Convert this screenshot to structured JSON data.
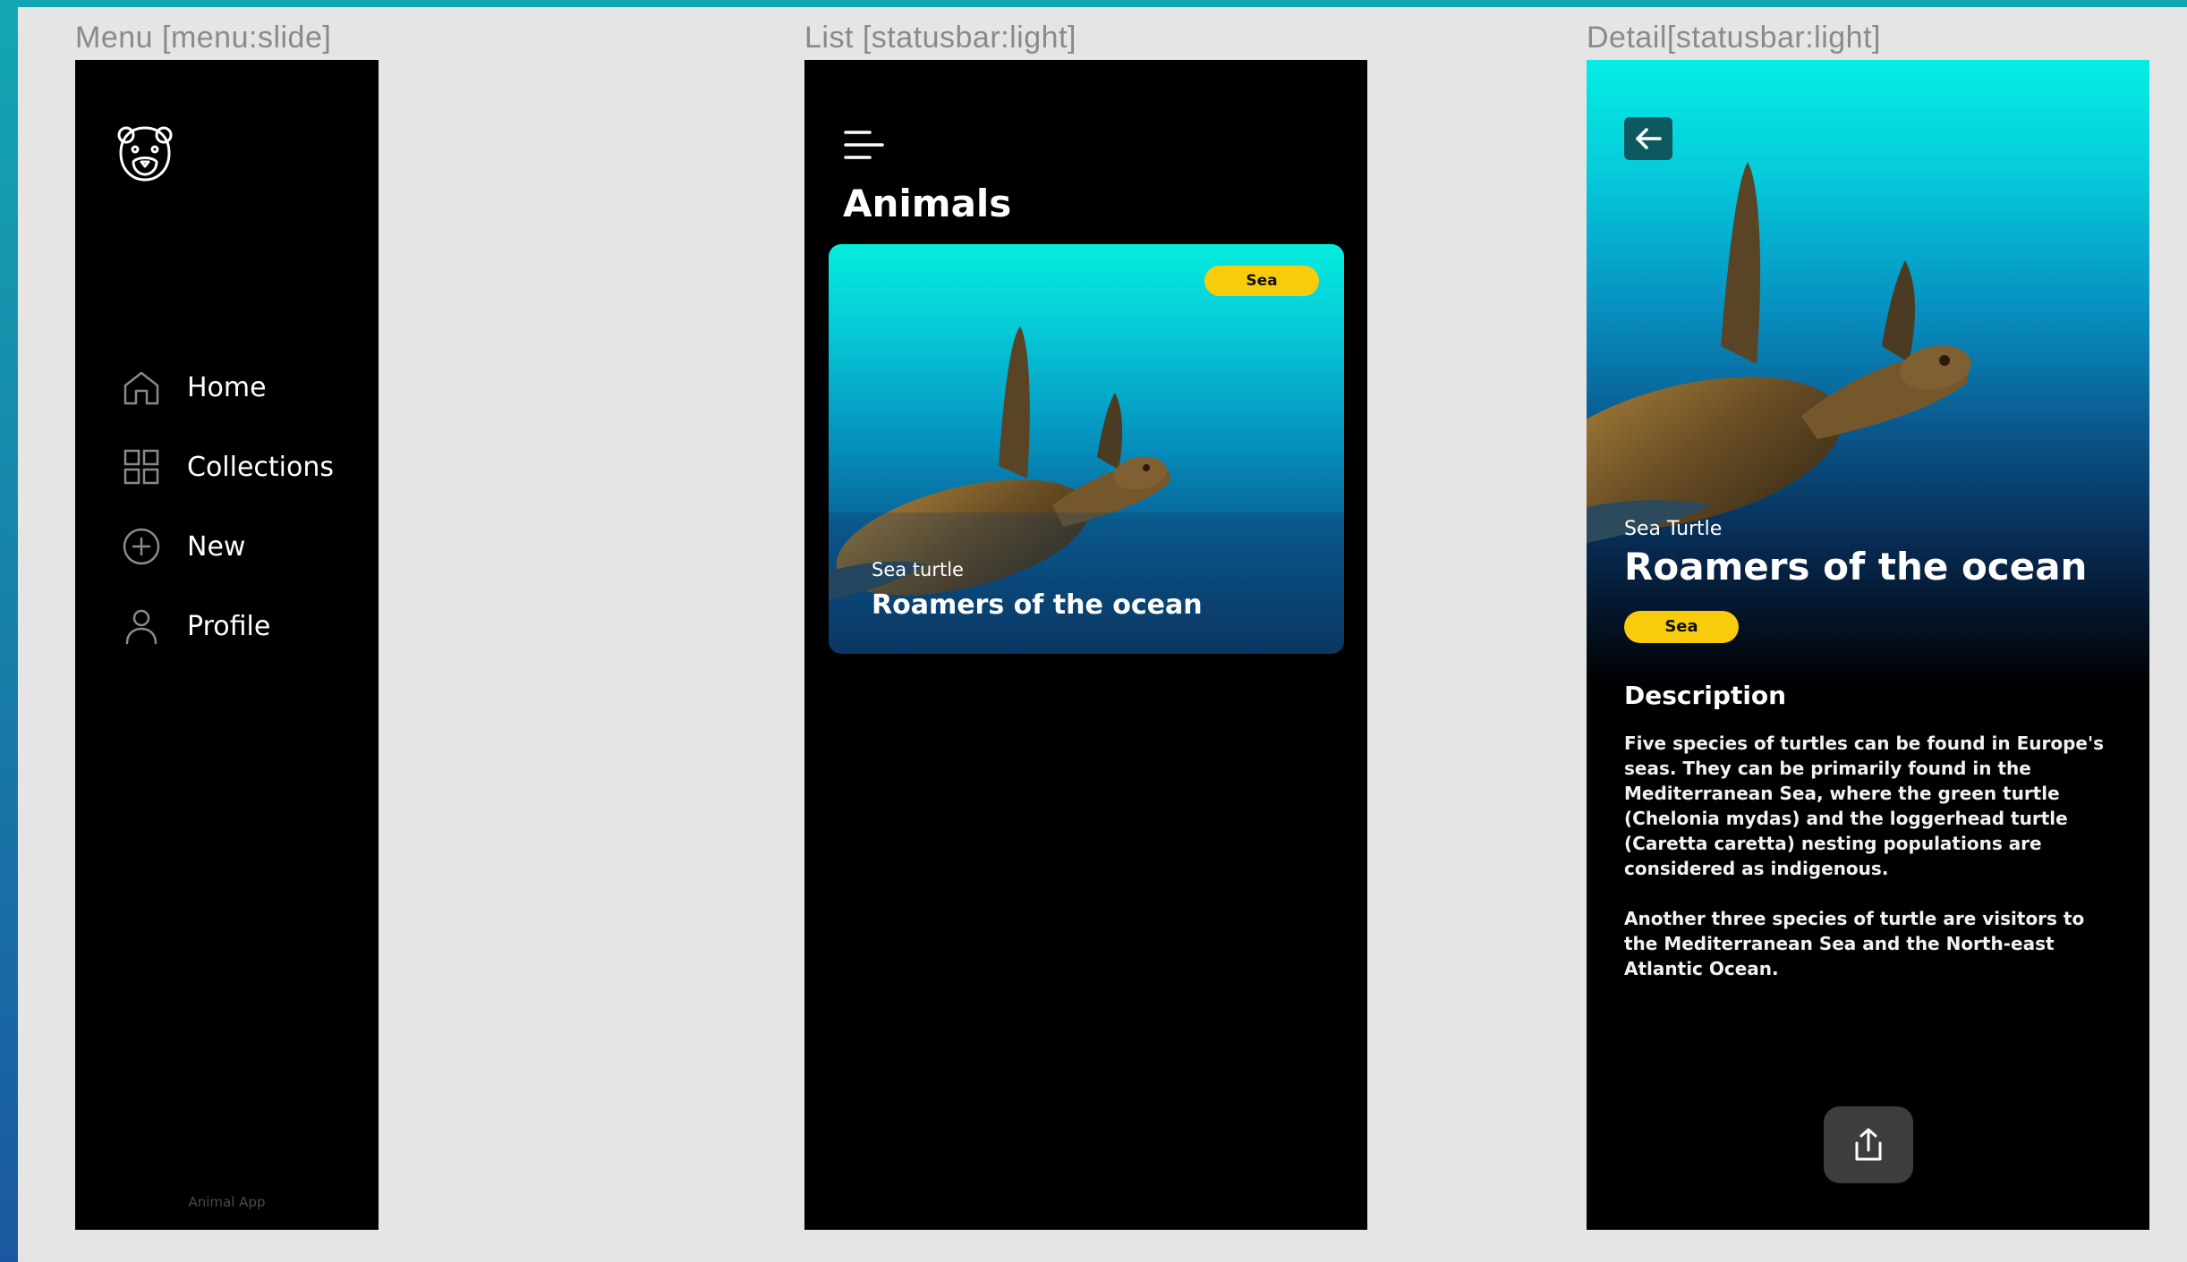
{
  "frames": {
    "menu": {
      "label": "Menu [menu:slide]"
    },
    "list": {
      "label": "List [statusbar:light]"
    },
    "detail": {
      "label": "Detail[statusbar:light]"
    }
  },
  "menu": {
    "logo_icon": "bear-logo-icon",
    "items": [
      {
        "label": "Home",
        "icon": "home-icon"
      },
      {
        "label": "Collections",
        "icon": "grid-icon"
      },
      {
        "label": "New",
        "icon": "plus-circle-icon"
      },
      {
        "label": "Profile",
        "icon": "user-icon"
      }
    ],
    "footer": "Animal App"
  },
  "list": {
    "title": "Animals",
    "card": {
      "badge": "Sea",
      "subtitle": "Sea turtle",
      "title": "Roamers of the ocean"
    }
  },
  "detail": {
    "subtitle": "Sea Turtle",
    "title": "Roamers of the ocean",
    "badge": "Sea",
    "description_heading": "Description",
    "paragraphs": [
      "Five species of turtles can be found in Europe's seas. They can be primarily found in the Mediterranean Sea, where the green turtle (Chelonia mydas) and the loggerhead turtle (Caretta caretta) nesting populations are considered as indigenous.",
      "Another three species of turtle are visitors to the Mediterranean Sea and the North-east Atlantic Ocean."
    ]
  },
  "colors": {
    "background_gradient_top": "#14a7b2",
    "canvas": "#e5e5e5",
    "screen": "#000000",
    "badge": "#f9cc0b",
    "back_button": "#0e5860",
    "share_button": "#3d3d3d"
  }
}
